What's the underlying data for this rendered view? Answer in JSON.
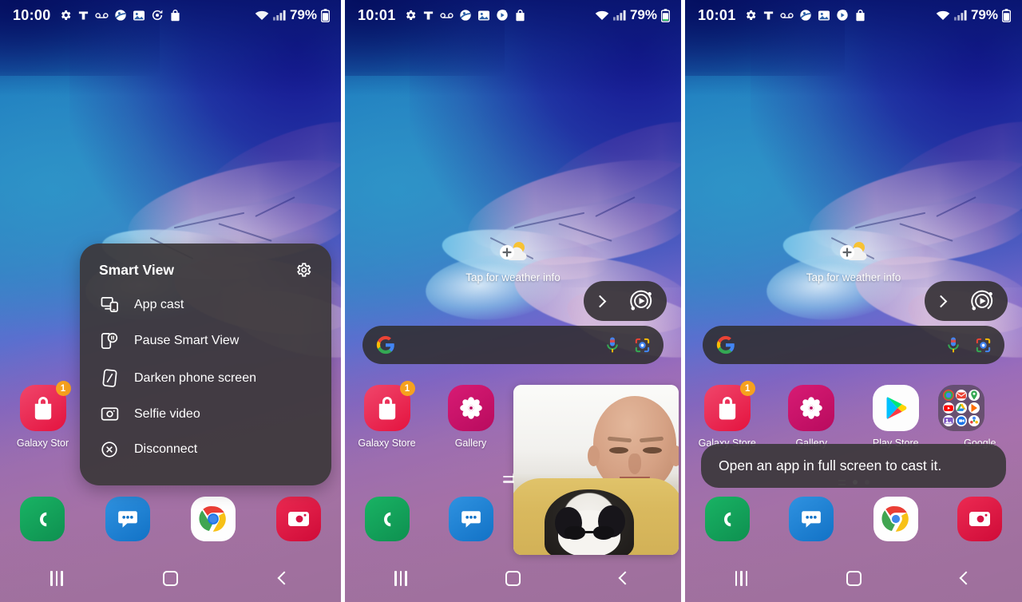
{
  "meta": {
    "device": "Samsung Galaxy phone home screen",
    "panel_count": 3
  },
  "colors": {
    "panel_bg": "#3d383c",
    "badge_orange": "#f6a11e",
    "galaxy_store_pink": "#ee2a4f",
    "gallery_magenta": "#c8136a",
    "phone_green": "#16a05c",
    "messages_blue": "#1a7fd4",
    "camera_red": "#e0123f",
    "status_text": "#ffffff"
  },
  "panels": [
    {
      "id": "panel-1",
      "statusbar": {
        "time": "10:00",
        "battery_percent": "79%",
        "left_icons": [
          "gear-icon",
          "t-mobile-icon",
          "voicemail-icon",
          "smart-view-icon",
          "photos-icon",
          "sync-icon",
          "galaxy-store-icon"
        ],
        "right_icons": [
          "wifi-icon",
          "signal-icon",
          "battery-icon"
        ]
      },
      "smart_view_menu": {
        "title": "Smart View",
        "settings_icon": "gear-icon",
        "items": [
          {
            "label": "App cast",
            "icon": "screen-cast-icon"
          },
          {
            "label": "Pause Smart View",
            "icon": "pause-cast-icon"
          },
          {
            "label": "Darken phone screen",
            "icon": "dim-screen-icon"
          },
          {
            "label": "Selfie video",
            "icon": "camera-icon"
          },
          {
            "label": "Disconnect",
            "icon": "close-circle-icon"
          }
        ]
      },
      "apps": [
        {
          "label": "Galaxy Stor",
          "icon": "galaxy-store-icon",
          "badge": "1"
        }
      ],
      "dock": [
        {
          "label": "",
          "icon": "phone-icon"
        },
        {
          "label": "",
          "icon": "messages-icon"
        },
        {
          "label": "",
          "icon": "chrome-icon"
        },
        {
          "label": "",
          "icon": "camera-icon"
        }
      ],
      "navbar": [
        "recents-icon",
        "home-icon",
        "back-icon"
      ]
    },
    {
      "id": "panel-2",
      "statusbar": {
        "time": "10:01",
        "battery_percent": "79%",
        "left_icons": [
          "gear-icon",
          "t-mobile-icon",
          "voicemail-icon",
          "smart-view-icon",
          "photos-icon",
          "cast-active-icon",
          "galaxy-store-icon"
        ],
        "right_icons": [
          "wifi-icon",
          "signal-icon",
          "battery-icon"
        ]
      },
      "weather_widget": {
        "label": "Tap for weather info",
        "icon": "add-weather-icon"
      },
      "search_bar": {
        "logo": "google-g-icon",
        "mic_icon": "microphone-icon",
        "lens_icon": "google-lens-icon",
        "placeholder": ""
      },
      "smart_view_pill": {
        "expand_icon": "chevron-right-icon",
        "cast_icon": "smart-view-cast-icon"
      },
      "apps": [
        {
          "label": "Galaxy Store",
          "icon": "galaxy-store-icon",
          "badge": "1"
        },
        {
          "label": "Gallery",
          "icon": "gallery-icon",
          "badge": ""
        }
      ],
      "selfie_window": {
        "name": "selfie-video-preview",
        "handle": "drag-handle"
      },
      "dock": [
        {
          "label": "",
          "icon": "phone-icon"
        },
        {
          "label": "",
          "icon": "messages-icon"
        }
      ],
      "navbar": [
        "recents-icon",
        "home-icon",
        "back-icon"
      ]
    },
    {
      "id": "panel-3",
      "statusbar": {
        "time": "10:01",
        "battery_percent": "79%",
        "left_icons": [
          "gear-icon",
          "t-mobile-icon",
          "voicemail-icon",
          "smart-view-icon",
          "photos-icon",
          "cast-active-icon",
          "galaxy-store-icon"
        ],
        "right_icons": [
          "wifi-icon",
          "signal-icon",
          "battery-icon"
        ]
      },
      "weather_widget": {
        "label": "Tap for weather info",
        "icon": "add-weather-icon"
      },
      "search_bar": {
        "logo": "google-g-icon",
        "mic_icon": "microphone-icon",
        "lens_icon": "google-lens-icon",
        "placeholder": ""
      },
      "smart_view_pill": {
        "expand_icon": "chevron-right-icon",
        "cast_icon": "smart-view-cast-icon"
      },
      "apps": [
        {
          "label": "Galaxy Store",
          "icon": "galaxy-store-icon",
          "badge": "1"
        },
        {
          "label": "Gallery",
          "icon": "gallery-icon",
          "badge": ""
        },
        {
          "label": "Play Store",
          "icon": "play-store-icon",
          "badge": ""
        },
        {
          "label": "Google",
          "icon": "google-folder-icon",
          "badge": ""
        }
      ],
      "toast": {
        "message": "Open an app in full screen to cast it."
      },
      "dock": [
        {
          "label": "",
          "icon": "phone-icon"
        },
        {
          "label": "",
          "icon": "messages-icon"
        },
        {
          "label": "",
          "icon": "chrome-icon"
        },
        {
          "label": "",
          "icon": "camera-icon"
        }
      ],
      "navbar": [
        "recents-icon",
        "home-icon",
        "back-icon"
      ]
    }
  ]
}
